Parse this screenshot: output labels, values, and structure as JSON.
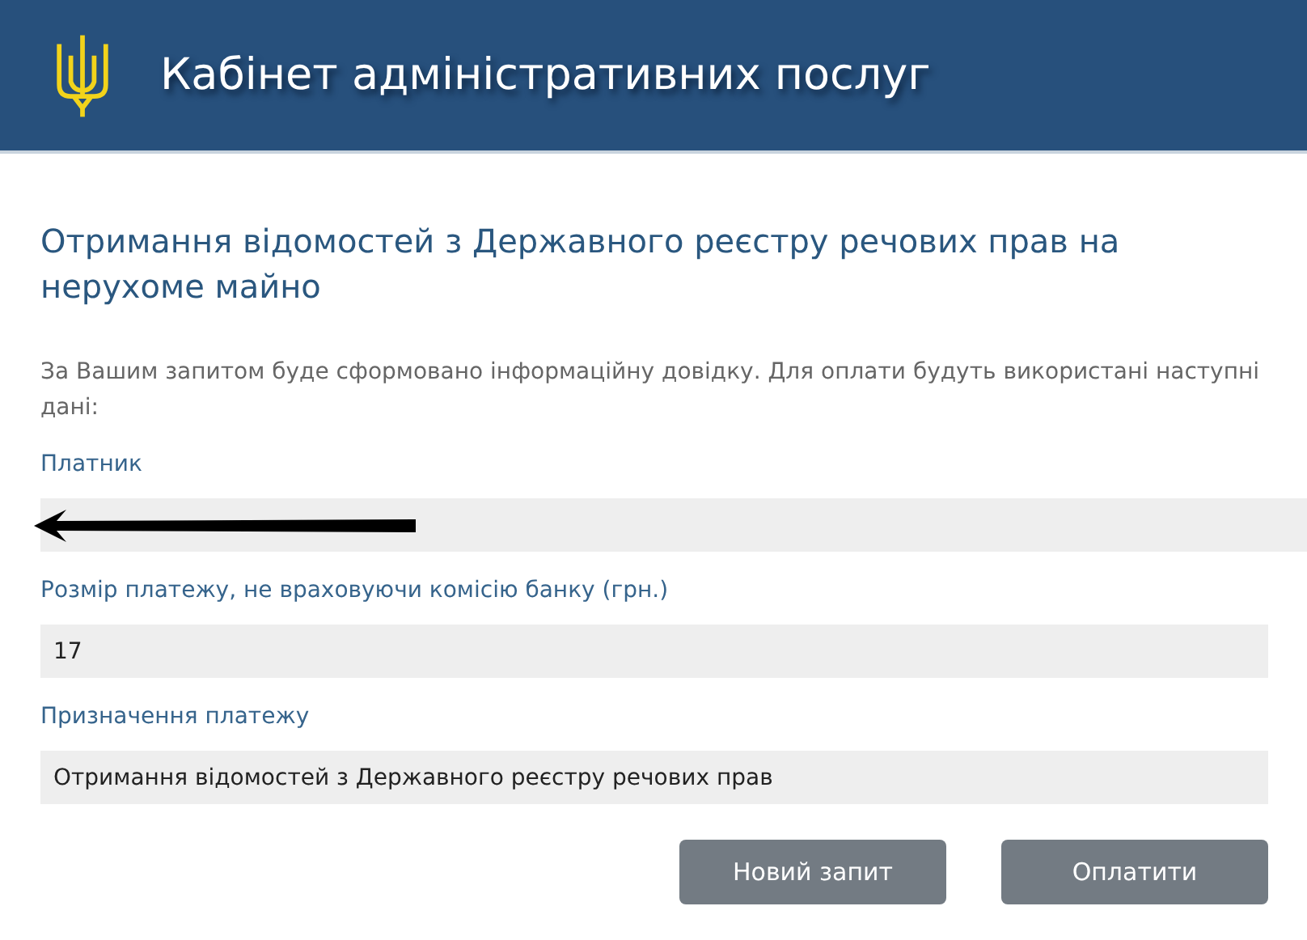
{
  "header": {
    "title": "Кабінет адміністративних послуг"
  },
  "page": {
    "heading": "Отримання відомостей з Державного реєстру речових прав на нерухоме майно",
    "intro": "За Вашим запитом буде сформовано інформаційну довідку. Для оплати будуть використані наступні дані:"
  },
  "fields": [
    {
      "label": "Платник",
      "redacted": true
    },
    {
      "label": "Розмір платежу, не враховуючи комісію банку (грн.)",
      "value": "17",
      "redacted": false
    },
    {
      "label": "Призначення платежу",
      "value": "Отримання відомостей з Державного реєстру речових прав",
      "redacted": false
    }
  ],
  "buttons": [
    "Новий запит",
    "Оплатити"
  ]
}
